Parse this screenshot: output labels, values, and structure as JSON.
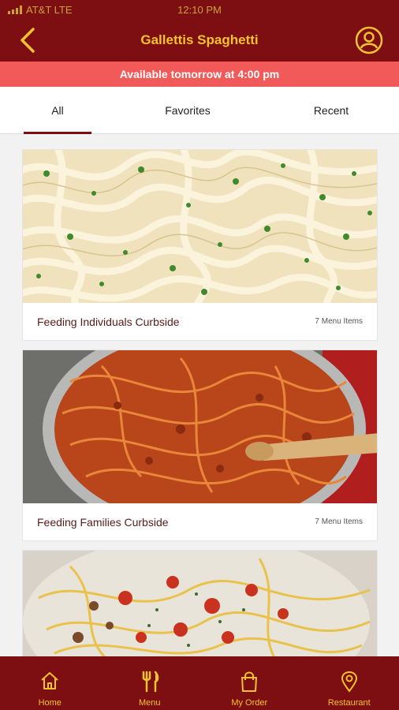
{
  "status_bar": {
    "carrier": "AT&T LTE",
    "time": "12:10 PM"
  },
  "header": {
    "title": "Gallettis Spaghetti"
  },
  "banner": {
    "text": "Available tomorrow at 4:00 pm"
  },
  "tabs": [
    {
      "label": "All",
      "active": true
    },
    {
      "label": "Favorites",
      "active": false
    },
    {
      "label": "Recent",
      "active": false
    }
  ],
  "cards": [
    {
      "title": "Feeding Individuals Curbside",
      "count": "7 Menu Items",
      "image": "fettuccine-alfredo-photo"
    },
    {
      "title": "Feeding Families Curbside",
      "count": "7 Menu Items",
      "image": "spaghetti-bolognese-photo"
    },
    {
      "title": "",
      "count": "",
      "image": "spaghetti-meat-sauce-photo"
    }
  ],
  "bottom_nav": [
    {
      "label": "Home",
      "icon": "home-icon"
    },
    {
      "label": "Menu",
      "icon": "fork-knife-icon"
    },
    {
      "label": "My Order",
      "icon": "shopping-bag-icon"
    },
    {
      "label": "Restaurant",
      "icon": "map-pin-icon"
    }
  ],
  "colors": {
    "brand": "#7d0f12",
    "accent": "#f2c230",
    "banner": "#f25a5a"
  }
}
